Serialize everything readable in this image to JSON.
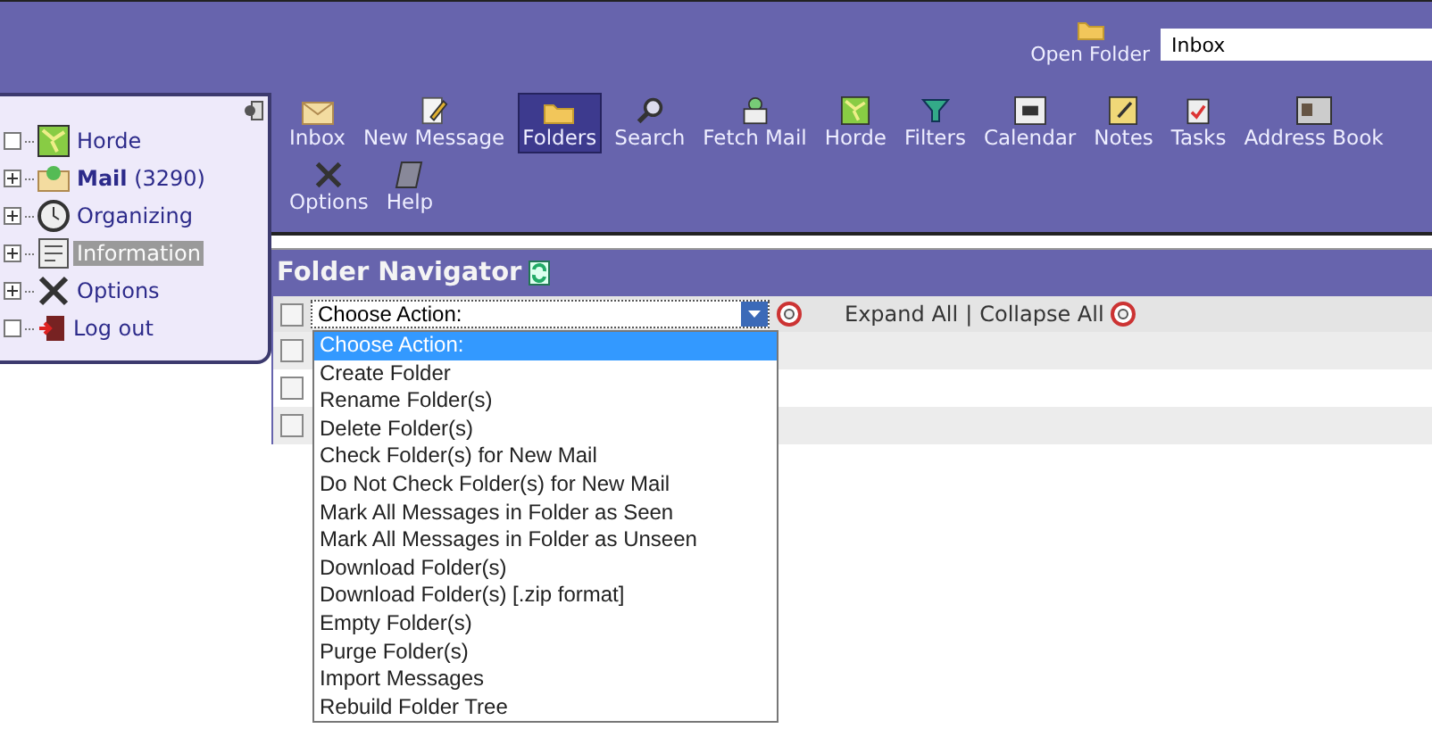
{
  "header": {
    "open_folder": {
      "label": "Open Folder"
    },
    "folder_field": {
      "value": "Inbox"
    }
  },
  "sidebar": {
    "items": [
      {
        "label": "Horde",
        "expandable": false,
        "selected": false
      },
      {
        "label": "**Mail** (3290)",
        "expandable": true,
        "selected": false
      },
      {
        "label": "Organizing",
        "expandable": true,
        "selected": false
      },
      {
        "label": "Information",
        "expandable": true,
        "selected": true
      },
      {
        "label": "Options",
        "expandable": true,
        "selected": false
      },
      {
        "label": "Log out",
        "expandable": false,
        "selected": false
      }
    ]
  },
  "toolbar": {
    "rows": [
      [
        {
          "label": "Inbox",
          "selected": false
        },
        {
          "label": "New Message",
          "selected": false
        },
        {
          "label": "Folders",
          "selected": true
        },
        {
          "label": "Search",
          "selected": false
        },
        {
          "label": "Fetch Mail",
          "selected": false
        },
        {
          "label": "Horde",
          "selected": false
        },
        {
          "label": "Filters",
          "selected": false
        },
        {
          "label": "Calendar",
          "selected": false
        },
        {
          "label": "Notes",
          "selected": false
        },
        {
          "label": "Tasks",
          "selected": false
        },
        {
          "label": "Address Book",
          "selected": false
        }
      ],
      [
        {
          "label": "Options",
          "selected": false
        },
        {
          "label": "Help",
          "selected": false
        }
      ]
    ]
  },
  "folder_navigator": {
    "title": "Folder Navigator",
    "action_select": {
      "value": "Choose Action:",
      "expanded": true,
      "options": [
        {
          "label": "Choose Action:",
          "selected": true
        },
        {
          "label": "Create Folder",
          "selected": false
        },
        {
          "label": "Rename Folder(s)",
          "selected": false
        },
        {
          "label": "Delete Folder(s)",
          "selected": false
        },
        {
          "label": "Check Folder(s) for New Mail",
          "selected": false
        },
        {
          "label": "Do Not Check Folder(s) for New Mail",
          "selected": false
        },
        {
          "label": "Mark All Messages in Folder as Seen",
          "selected": false
        },
        {
          "label": "Mark All Messages in Folder as Unseen",
          "selected": false
        },
        {
          "label": "Download Folder(s)",
          "selected": false
        },
        {
          "label": "Download Folder(s) [.zip format]",
          "selected": false
        },
        {
          "label": "Empty Folder(s)",
          "selected": false
        },
        {
          "label": "Purge Folder(s)",
          "selected": false
        },
        {
          "label": "Import Messages",
          "selected": false
        },
        {
          "label": "Rebuild Folder Tree",
          "selected": false
        }
      ]
    },
    "expand_all": "Expand All",
    "separator": "|",
    "collapse_all": "Collapse All",
    "header_checkbox": {
      "checked": false
    },
    "rows": [
      {
        "checked": false
      },
      {
        "checked": false
      },
      {
        "checked": false
      }
    ]
  }
}
